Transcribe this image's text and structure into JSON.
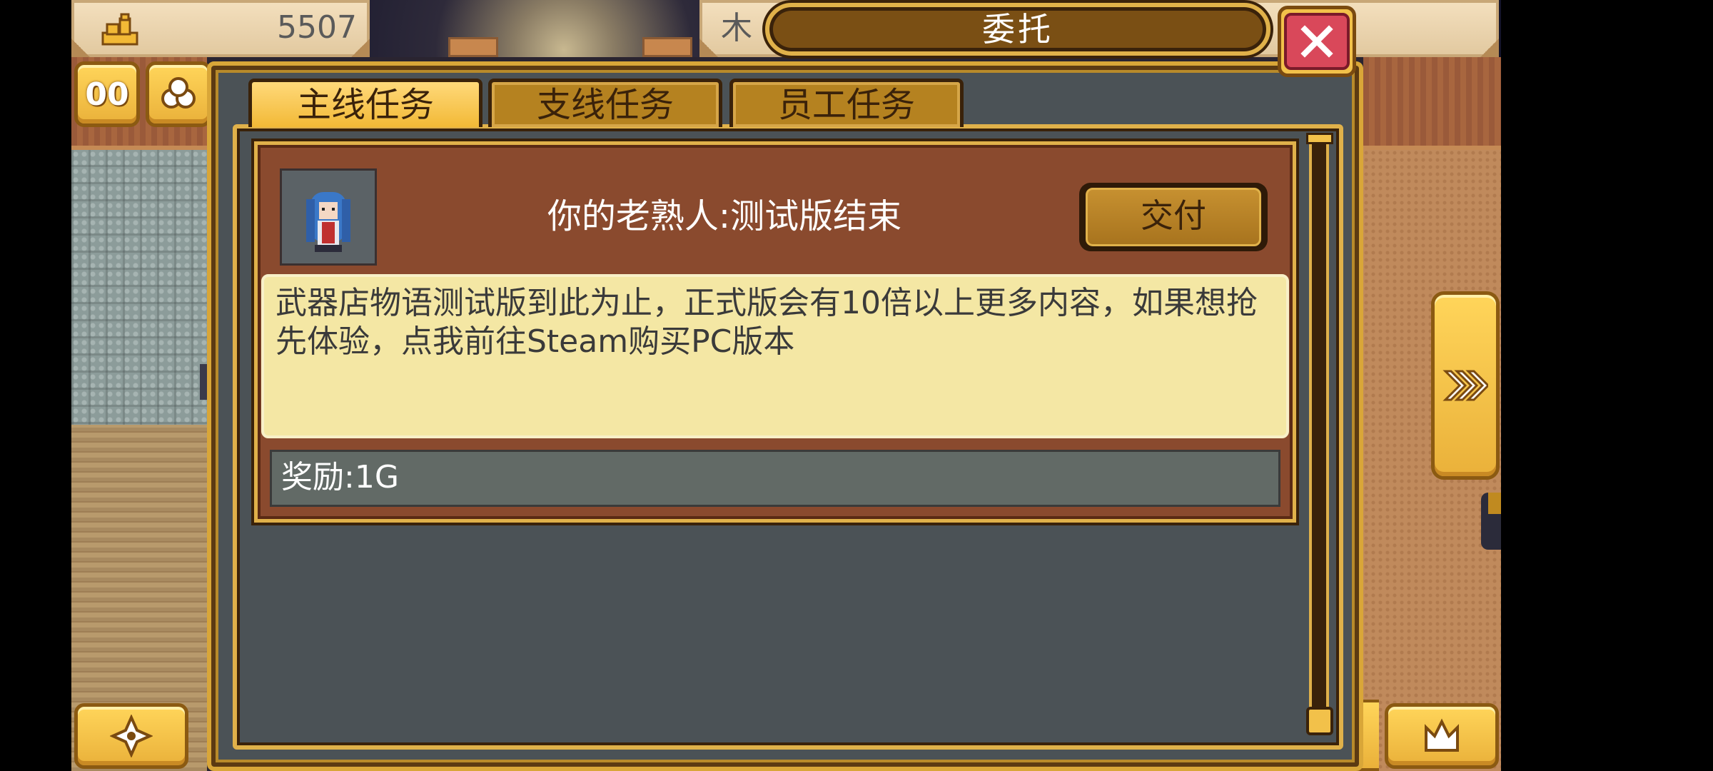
{
  "hud": {
    "money_value": "5507",
    "wood_label": "木",
    "money_icon": "gold-bars-icon",
    "pause_label": "00"
  },
  "dialog": {
    "title": "委托",
    "tabs": [
      {
        "label": "主线任务",
        "active": true
      },
      {
        "label": "支线任务",
        "active": false
      },
      {
        "label": "员工任务",
        "active": false
      }
    ],
    "quest": {
      "title": "你的老熟人:测试版结束",
      "deliver_label": "交付",
      "description": "武器店物语测试版到此为止，正式版会有10倍以上更多内容，如果想抢先体验，点我前往Steam购买PC版本",
      "reward": "奖励:1G",
      "portrait": "blue-haired-girl-portrait"
    }
  },
  "colors": {
    "gold": "#f2c14a",
    "dark_brown": "#3a220a",
    "card_brown": "#8a4a2e",
    "parchment": "#f4e7a4",
    "panel_gray": "#4b5256",
    "close_red": "#d9485a"
  }
}
